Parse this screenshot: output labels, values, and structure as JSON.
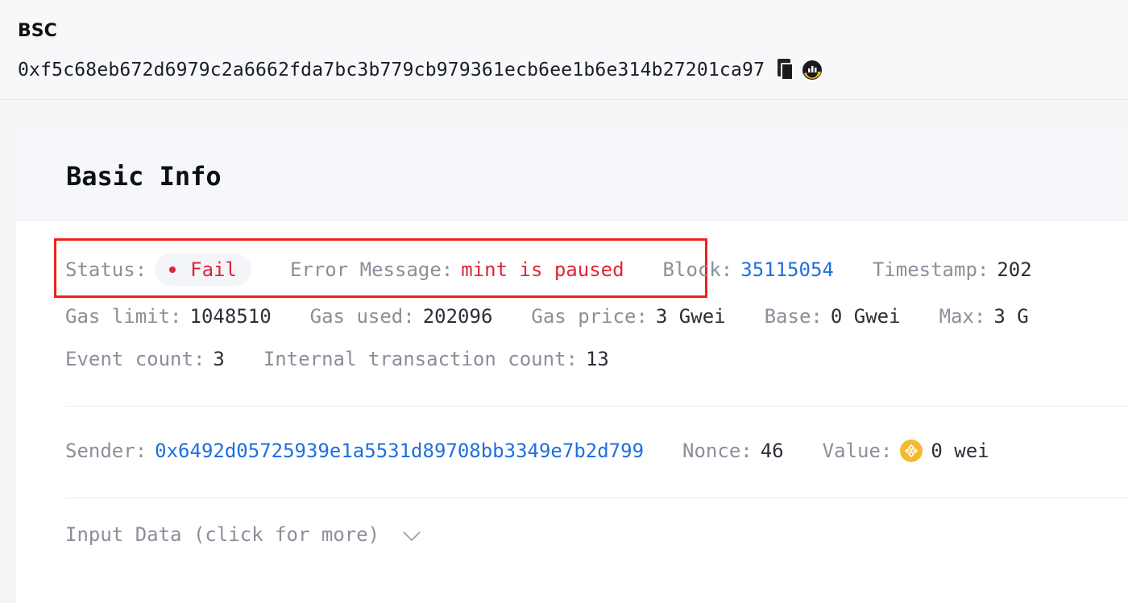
{
  "header": {
    "chain": "BSC",
    "tx_hash": "0xf5c68eb672d6979c2a6662fda7bc3b779cb979361ecb6ee1b6e314b27201ca97",
    "icons": [
      "copy-icon",
      "explorer-icon"
    ]
  },
  "basic_info": {
    "title": "Basic Info",
    "status_label": "Status:",
    "status_value": "Fail",
    "error_label": "Error Message:",
    "error_value": "mint is paused",
    "block_label": "Block:",
    "block_value": "35115054",
    "timestamp_label": "Timestamp:",
    "timestamp_value": "202",
    "gas_limit_label": "Gas limit:",
    "gas_limit_value": "1048510",
    "gas_used_label": "Gas used:",
    "gas_used_value": "202096",
    "gas_price_label": "Gas price:",
    "gas_price_value": "3 Gwei",
    "base_label": "Base:",
    "base_value": "0 Gwei",
    "max_label": "Max:",
    "max_value": "3 G",
    "event_count_label": "Event count:",
    "event_count_value": "3",
    "internal_tx_label": "Internal transaction count:",
    "internal_tx_value": "13",
    "sender_label": "Sender:",
    "sender_value": "0x6492d05725939e1a5531d89708bb3349e7b2d799",
    "nonce_label": "Nonce:",
    "nonce_value": "46",
    "value_label": "Value:",
    "value_value": "0 wei",
    "input_data_label": "Input Data (click for more)"
  },
  "colors": {
    "fail": "#e0243a",
    "link": "#1f6fe0",
    "highlight_box": "#f0211d",
    "bnb": "#f3ba2f"
  }
}
